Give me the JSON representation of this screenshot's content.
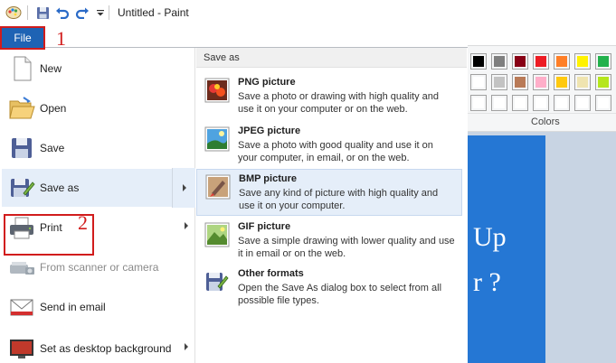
{
  "window": {
    "title": "Untitled - Paint"
  },
  "quick_access": {
    "icons": [
      "paint-app-icon",
      "save-icon",
      "undo-icon",
      "redo-icon",
      "customize-dropdown-icon"
    ]
  },
  "file_tab": {
    "label": "File"
  },
  "annotations": {
    "step1": "1",
    "step2": "2"
  },
  "file_menu": {
    "items": [
      {
        "label": "New",
        "icon": "new-file-icon",
        "has_submenu": false,
        "disabled": false
      },
      {
        "label": "Open",
        "icon": "open-folder-icon",
        "has_submenu": false,
        "disabled": false
      },
      {
        "label": "Save",
        "icon": "floppy-save-icon",
        "has_submenu": false,
        "disabled": false
      },
      {
        "label": "Save as",
        "icon": "save-as-icon",
        "has_submenu": true,
        "disabled": false
      },
      {
        "label": "Print",
        "icon": "printer-icon",
        "has_submenu": true,
        "disabled": false
      },
      {
        "label": "From scanner or camera",
        "icon": "scanner-icon",
        "has_submenu": false,
        "disabled": true
      },
      {
        "label": "Send in email",
        "icon": "email-icon",
        "has_submenu": false,
        "disabled": false
      },
      {
        "label": "Set as desktop background",
        "icon": "desktop-background-icon",
        "has_submenu": true,
        "disabled": false
      }
    ]
  },
  "save_as_submenu": {
    "header": "Save as",
    "items": [
      {
        "title": "PNG picture",
        "description": "Save a photo or drawing with high quality and use it on your computer or on the web.",
        "icon": "png-picture-icon"
      },
      {
        "title": "JPEG picture",
        "description": "Save a photo with good quality and use it on your computer, in email, or on the web.",
        "icon": "jpeg-picture-icon"
      },
      {
        "title": "BMP picture",
        "description": "Save any kind of picture with high quality and use it on your computer.",
        "icon": "bmp-picture-icon"
      },
      {
        "title": "GIF picture",
        "description": "Save a simple drawing with lower quality and use it in email or on the web.",
        "icon": "gif-picture-icon"
      },
      {
        "title": "Other formats",
        "description": "Open the Save As dialog box to select from all possible file types.",
        "icon": "other-formats-icon"
      }
    ]
  },
  "ribbon": {
    "colors_label": "Colors",
    "palette_row1": [
      "#000000",
      "#7f7f7f",
      "#880015",
      "#ed1c24",
      "#ff7f27",
      "#fff200",
      "#22b14c"
    ],
    "palette_row2": [
      "#ffffff",
      "#c3c3c3",
      "#b97a57",
      "#ffaec9",
      "#ffc90e",
      "#efe4b0",
      "#b5e61d"
    ],
    "palette_row3": [
      "#ffffff",
      "#ffffff",
      "#ffffff",
      "#ffffff",
      "#ffffff",
      "#ffffff",
      "#ffffff"
    ]
  },
  "canvas": {
    "text_line1": "Up",
    "text_line2": "r ?"
  }
}
